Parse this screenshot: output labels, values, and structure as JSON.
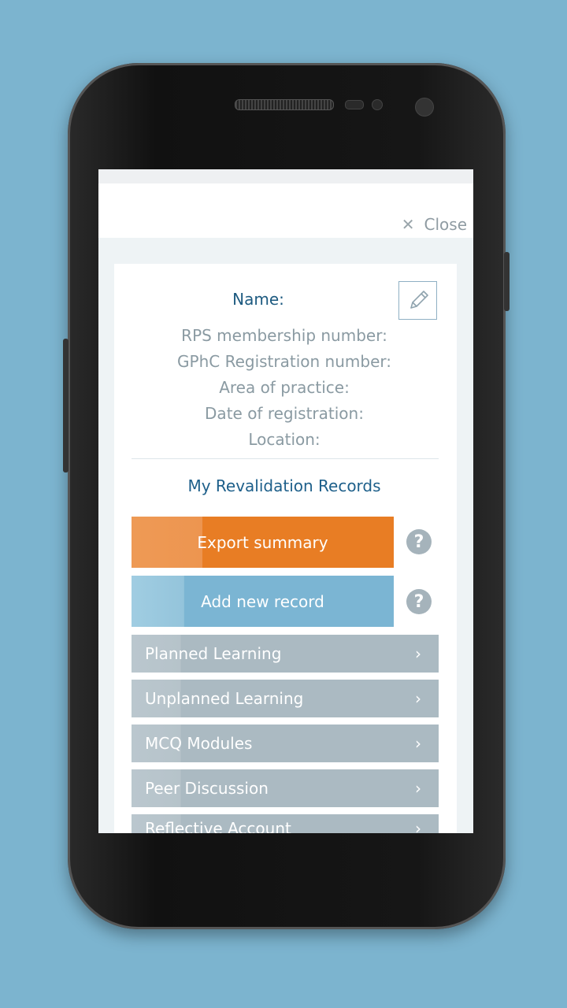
{
  "header": {
    "close_label": "Close",
    "close_icon": "close-x-icon"
  },
  "profile": {
    "name_label": "Name:",
    "fields": [
      "RPS membership number:",
      "GPhC Registration number:",
      "Area of practice:",
      "Date of registration:",
      "Location:"
    ],
    "edit_icon": "pencil-icon"
  },
  "records": {
    "title": "My Revalidation Records",
    "export_label": "Export summary",
    "add_label": "Add new record",
    "help_icon": "question-icon",
    "items": [
      {
        "label": "Planned Learning"
      },
      {
        "label": "Unplanned Learning"
      },
      {
        "label": "MCQ Modules"
      },
      {
        "label": "Peer Discussion"
      },
      {
        "label": "Reflective Account"
      }
    ]
  },
  "colors": {
    "background": "#7cb4cf",
    "export": "#e87d24",
    "add": "#7bb5d3",
    "list_item": "#abbac2",
    "heading": "#1d5a80"
  }
}
